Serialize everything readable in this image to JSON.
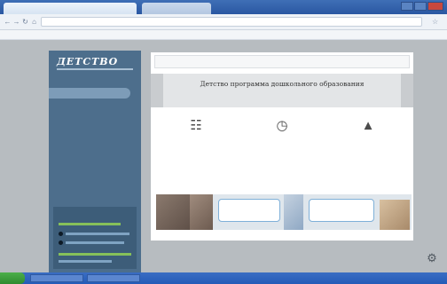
{
  "browser": {
    "tabs": [
      {
        "label": ""
      },
      {
        "label": ""
      }
    ],
    "address": "",
    "bookmarks": ""
  },
  "site": {
    "logo": "ДЕТСТВО",
    "menu": [
      {
        "label": "",
        "active": true
      },
      {
        "label": ""
      },
      {
        "label": ""
      },
      {
        "label": ""
      },
      {
        "label": ""
      },
      {
        "label": ""
      },
      {
        "label": ""
      }
    ],
    "search_placeholder": "",
    "banner_title": "Детство программа дошкольного образования",
    "features": [
      {
        "icon": "easel-icon",
        "title": "",
        "desc": ""
      },
      {
        "icon": "clock-icon",
        "title": "",
        "desc": ""
      },
      {
        "icon": "graduation-cap-icon",
        "title": "",
        "desc": ""
      }
    ],
    "cards": [
      {
        "text": ""
      },
      {
        "text": ""
      }
    ]
  },
  "colors": {
    "sidebar": "#4d6e8c",
    "page_bg": "#b7bcc0",
    "accent": "#3b78b0"
  }
}
